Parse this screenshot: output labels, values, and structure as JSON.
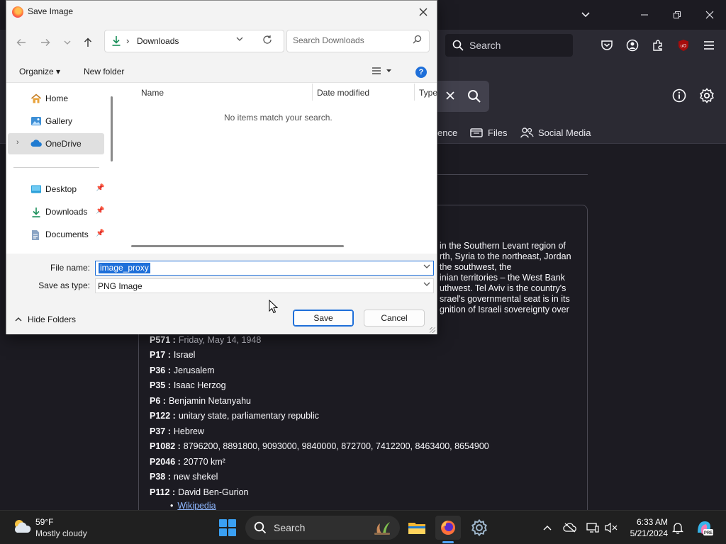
{
  "browser": {
    "search_placeholder": "Search"
  },
  "app": {
    "tabs": [
      {
        "label": "ence"
      },
      {
        "label": "Files"
      },
      {
        "label": "Social Media"
      }
    ],
    "description_lines": [
      "in the Southern Levant region of",
      "rth, Syria to the northeast, Jordan",
      "the southwest, the",
      "inian territories – the West Bank",
      "uthwest. Tel Aviv is the country's",
      "srael's governmental seat is in its",
      "gnition of Israeli sovereignty over"
    ],
    "properties": [
      {
        "key": "P571 :",
        "value": "Friday, May 14, 1948",
        "dim": true
      },
      {
        "key": "P17 :",
        "value": "Israel"
      },
      {
        "key": "P36 :",
        "value": "Jerusalem"
      },
      {
        "key": "P35 :",
        "value": "Isaac Herzog"
      },
      {
        "key": "P6 :",
        "value": "Benjamin Netanyahu"
      },
      {
        "key": "P122 :",
        "value": "unitary state, parliamentary republic"
      },
      {
        "key": "P37 :",
        "value": "Hebrew"
      },
      {
        "key": "P1082 :",
        "value": "8796200, 8891800, 9093000, 9840000, 872700, 7412200, 8463400, 8654900"
      },
      {
        "key": "P2046 :",
        "value": "20770 km²"
      },
      {
        "key": "P38 :",
        "value": "new shekel"
      },
      {
        "key": "P112 :",
        "value": "David Ben-Gurion"
      }
    ],
    "link_label": "Wikipedia"
  },
  "dialog": {
    "title": "Save Image",
    "address": "Downloads",
    "search_placeholder": "Search Downloads",
    "organize_label": "Organize ▾",
    "new_folder_label": "New folder",
    "nav_items": [
      {
        "label": "Home"
      },
      {
        "label": "Gallery"
      },
      {
        "label": "OneDrive"
      },
      {
        "label": "Desktop"
      },
      {
        "label": "Downloads"
      },
      {
        "label": "Documents"
      }
    ],
    "columns": {
      "name": "Name",
      "date": "Date modified",
      "type": "Type"
    },
    "empty_message": "No items match your search.",
    "file_name_label": "File name:",
    "file_name_value": "image_proxy",
    "save_type_label": "Save as type:",
    "save_type_value": "PNG Image",
    "hide_folders_label": "Hide Folders",
    "save_label": "Save",
    "cancel_label": "Cancel"
  },
  "taskbar": {
    "temperature": "59°F",
    "condition": "Mostly cloudy",
    "search_label": "Search",
    "time": "6:33 AM",
    "date": "5/21/2024"
  },
  "colors": {
    "accent": "#1e6fd9",
    "browser_bg": "#1c1b22",
    "toolbar_bg": "#2b2a33",
    "link": "#8fb8ff"
  }
}
